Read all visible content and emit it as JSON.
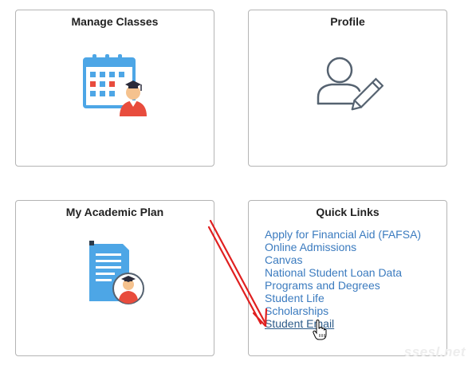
{
  "tiles": {
    "manage_classes": {
      "title": "Manage Classes",
      "icon": "calendar-student-icon"
    },
    "profile": {
      "title": "Profile",
      "icon": "user-edit-icon"
    },
    "academic_plan": {
      "title": "My Academic Plan",
      "icon": "document-student-icon"
    },
    "quick_links": {
      "title": "Quick Links",
      "links": [
        "Apply for Financial Aid (FAFSA)",
        "Online Admissions",
        "Canvas",
        "National Student Loan Data",
        "Programs and Degrees",
        "Student Life",
        "Scholarships",
        "Student Email"
      ],
      "hovered_link": "Student Email"
    }
  },
  "annotation": {
    "type": "red-arrow",
    "target": "Student Email",
    "color": "#e02020"
  },
  "colors": {
    "link": "#3b7bbf",
    "calendar_blue": "#4da6e6",
    "calendar_red": "#e84c3d",
    "icon_outline": "#556270"
  },
  "watermark": "ssesl.net"
}
